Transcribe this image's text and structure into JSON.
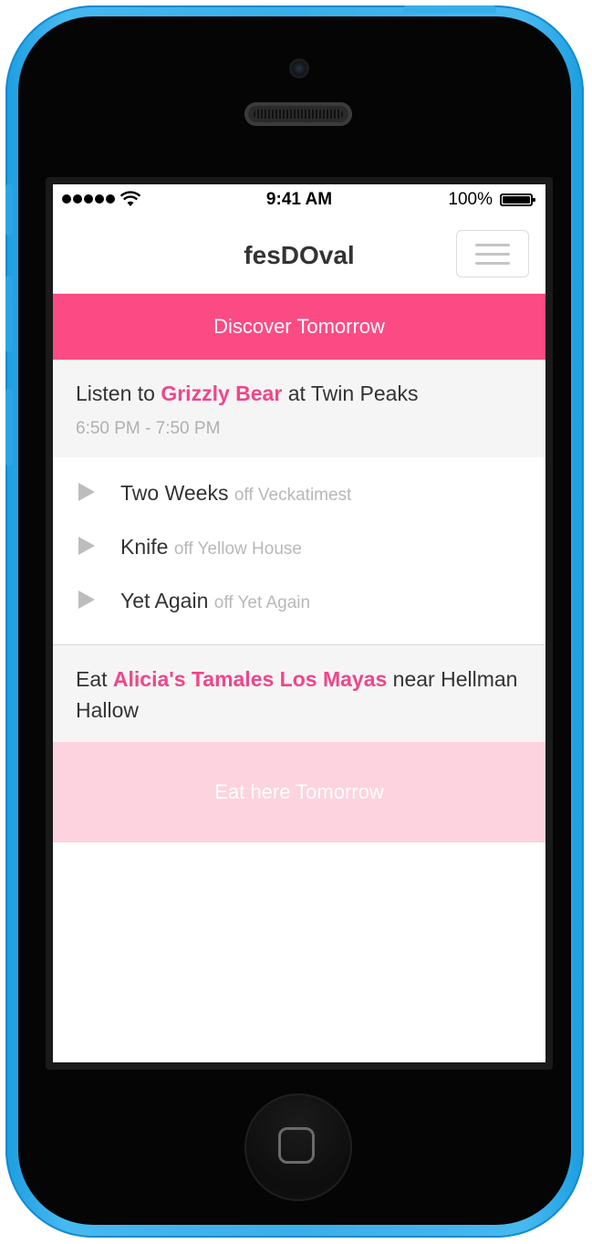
{
  "status_bar": {
    "time": "9:41 AM",
    "battery": "100%"
  },
  "navbar": {
    "brand": "fesDOval",
    "menu_icon": "hamburger-icon"
  },
  "discover_button": "Discover Tomorrow",
  "event": {
    "prefix": "Listen to",
    "artist": "Grizzly Bear",
    "suffix": "at Twin Peaks",
    "time": "6:50 PM - 7:50 PM"
  },
  "tracks": [
    {
      "title": "Two Weeks",
      "source": "off Veckatimest"
    },
    {
      "title": "Knife",
      "source": "off Yellow House"
    },
    {
      "title": "Yet Again",
      "source": "off Yet Again"
    }
  ],
  "food": {
    "prefix": "Eat",
    "vendor": "Alicia's Tamales Los Mayas",
    "suffix": "near Hellman Hallow",
    "button": "Eat here Tomorrow"
  },
  "colors": {
    "accent": "#fc4a84",
    "highlight": "#f0468a",
    "eat_button": "#fdd3df",
    "device": "#3aaee8"
  }
}
